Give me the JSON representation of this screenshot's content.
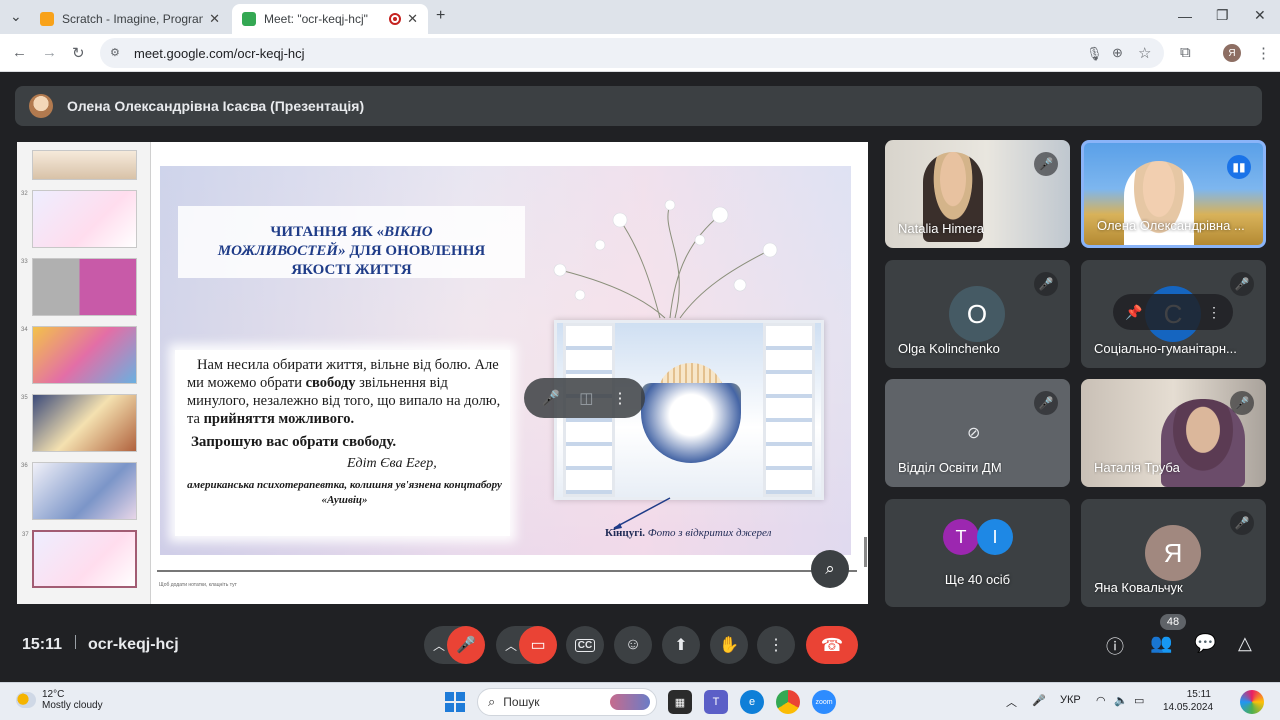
{
  "browser": {
    "tabs": [
      {
        "title": "Scratch - Imagine, Program, Sha",
        "active": false
      },
      {
        "title": "Meet: \"ocr-keqj-hcj\"",
        "active": true
      }
    ],
    "url": "meet.google.com/ocr-keqj-hcj",
    "profile_initial": "Я"
  },
  "meet": {
    "presenter": "Олена Олександрівна Ісаєва (Презентація)",
    "meeting_time": "15:11",
    "meeting_code": "ocr-keqj-hcj",
    "participants_badge": "48"
  },
  "slide": {
    "title_line1": "ЧИТАННЯ ЯК «",
    "title_ital1": "ВІКНО",
    "title_ital2": "МОЖЛИВОСТЕЙ»",
    "title_rest2": " ДЛЯ  ОНОВЛЕННЯ",
    "title_line3": "ЯКОСТІ ЖИТТЯ",
    "quote_part1": "Нам несила обирати життя, вільне від болю. Але ми можемо обрати ",
    "quote_bold1": "свободу",
    "quote_part2": " звільнення від минулого, незалежно від того, що випало на долю, та ",
    "quote_bold2": "прийняття можливого.",
    "invite": "Запрошую вас обрати свободу.",
    "author": "Едіт Єва Егер,",
    "author_role": "американська психотерапевтка, колишня ув'язнена концтабору «Аушвіц»",
    "caption_bold": "Кінцугі.",
    "caption_ital": " Фото з відкритих джерел",
    "thumb_numbers": [
      "32",
      "33",
      "34",
      "35",
      "36",
      "37"
    ],
    "notes_placeholder": "Щоб додати нотатки, клацніть тут"
  },
  "participants": [
    {
      "name": "Natalia Himera",
      "type": "video",
      "muted": true
    },
    {
      "name": "Олена Олександрівна ...",
      "type": "video",
      "muted": false,
      "speaking": true
    },
    {
      "name": "Olga Kolinchenko",
      "type": "avatar",
      "initial": "O",
      "color": "#455a64",
      "muted": true
    },
    {
      "name": "Соціально-гуманітарн...",
      "type": "avatar",
      "initial": "С",
      "color": "#1565c0",
      "muted": true
    },
    {
      "name": "Відділ Освіти ДМ",
      "type": "camera-off",
      "muted": true
    },
    {
      "name": "Наталія Труба",
      "type": "video",
      "muted": true
    },
    {
      "name": "Ще 40 осіб",
      "type": "group",
      "initials": [
        "T",
        "I"
      ]
    },
    {
      "name": "Яна Ковальчук",
      "type": "avatar",
      "initial": "Я",
      "color": "#a1887f",
      "muted": true
    }
  ],
  "taskbar": {
    "temperature": "12°C",
    "weather": "Mostly cloudy",
    "search_placeholder": "Пошук",
    "language": "УКР",
    "time": "15:11",
    "date": "14.05.2024"
  }
}
